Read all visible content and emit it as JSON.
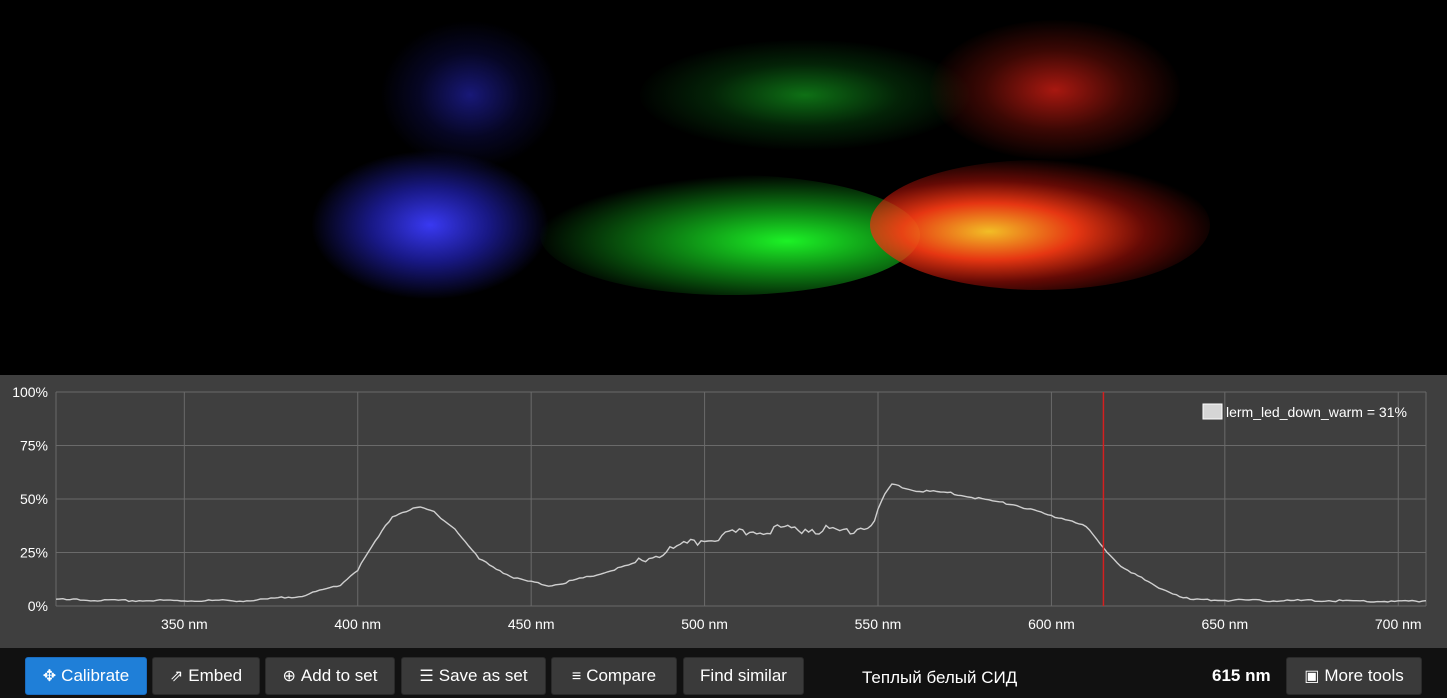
{
  "chart_data": {
    "type": "line",
    "y_ticks": [
      "0%",
      "25%",
      "50%",
      "75%",
      "100%"
    ],
    "y_tick_values": [
      0,
      25,
      50,
      75,
      100
    ],
    "x_ticks": [
      "350 nm",
      "400 nm",
      "450 nm",
      "500 nm",
      "550 nm",
      "600 nm",
      "650 nm",
      "700 nm"
    ],
    "x_tick_values": [
      350,
      400,
      450,
      500,
      550,
      600,
      650,
      700
    ],
    "xlim": [
      313,
      708
    ],
    "ylim": [
      0,
      100
    ],
    "grid": true,
    "legend_position": "top-right",
    "legend": "lerm_led_down_warm = 31%",
    "marker_nm": 615,
    "series": [
      {
        "name": "lerm_led_down_warm",
        "x": [
          313,
          330,
          350,
          370,
          385,
          395,
          400,
          405,
          410,
          415,
          418,
          422,
          428,
          435,
          445,
          455,
          460,
          470,
          480,
          490,
          500,
          510,
          520,
          530,
          540,
          548,
          552,
          554,
          560,
          570,
          580,
          590,
          600,
          606,
          610,
          615,
          620,
          630,
          640,
          660,
          680,
          700,
          708
        ],
        "y": [
          3,
          2.5,
          2.5,
          2.5,
          5,
          10,
          17,
          30,
          42,
          45,
          46,
          44,
          36,
          22,
          13,
          9.5,
          11,
          15,
          20,
          26,
          31,
          34,
          36,
          36,
          35,
          38,
          52,
          57,
          54,
          53,
          50,
          47,
          42,
          40,
          37,
          27,
          19,
          9,
          3,
          2.5,
          2.5,
          2,
          2.5
        ]
      }
    ]
  },
  "spectrum_colors": {
    "blue": "#2b2bff",
    "green": "#1aff2a",
    "orange": "#ffb020",
    "red": "#ff2a1a",
    "marker": "#d42020",
    "line": "#cfcfcf"
  },
  "toolbar": {
    "buttons": [
      {
        "label": "Calibrate",
        "icon": "crosshair-icon",
        "glyph": "✥"
      },
      {
        "label": "Embed",
        "icon": "share-icon",
        "glyph": "⇗"
      },
      {
        "label": "Add to set",
        "icon": "plus-circle-icon",
        "glyph": "⊕"
      },
      {
        "label": "Save as set",
        "icon": "list-icon",
        "glyph": "☰"
      },
      {
        "label": "Compare",
        "icon": "align-left-icon",
        "glyph": "≡"
      },
      {
        "label": "Find similar",
        "icon": "",
        "glyph": ""
      }
    ],
    "description": "Теплый белый СИД",
    "wavelength": "615 nm",
    "more_tools": {
      "label": "More tools",
      "icon": "briefcase-icon",
      "glyph": "▣"
    }
  }
}
